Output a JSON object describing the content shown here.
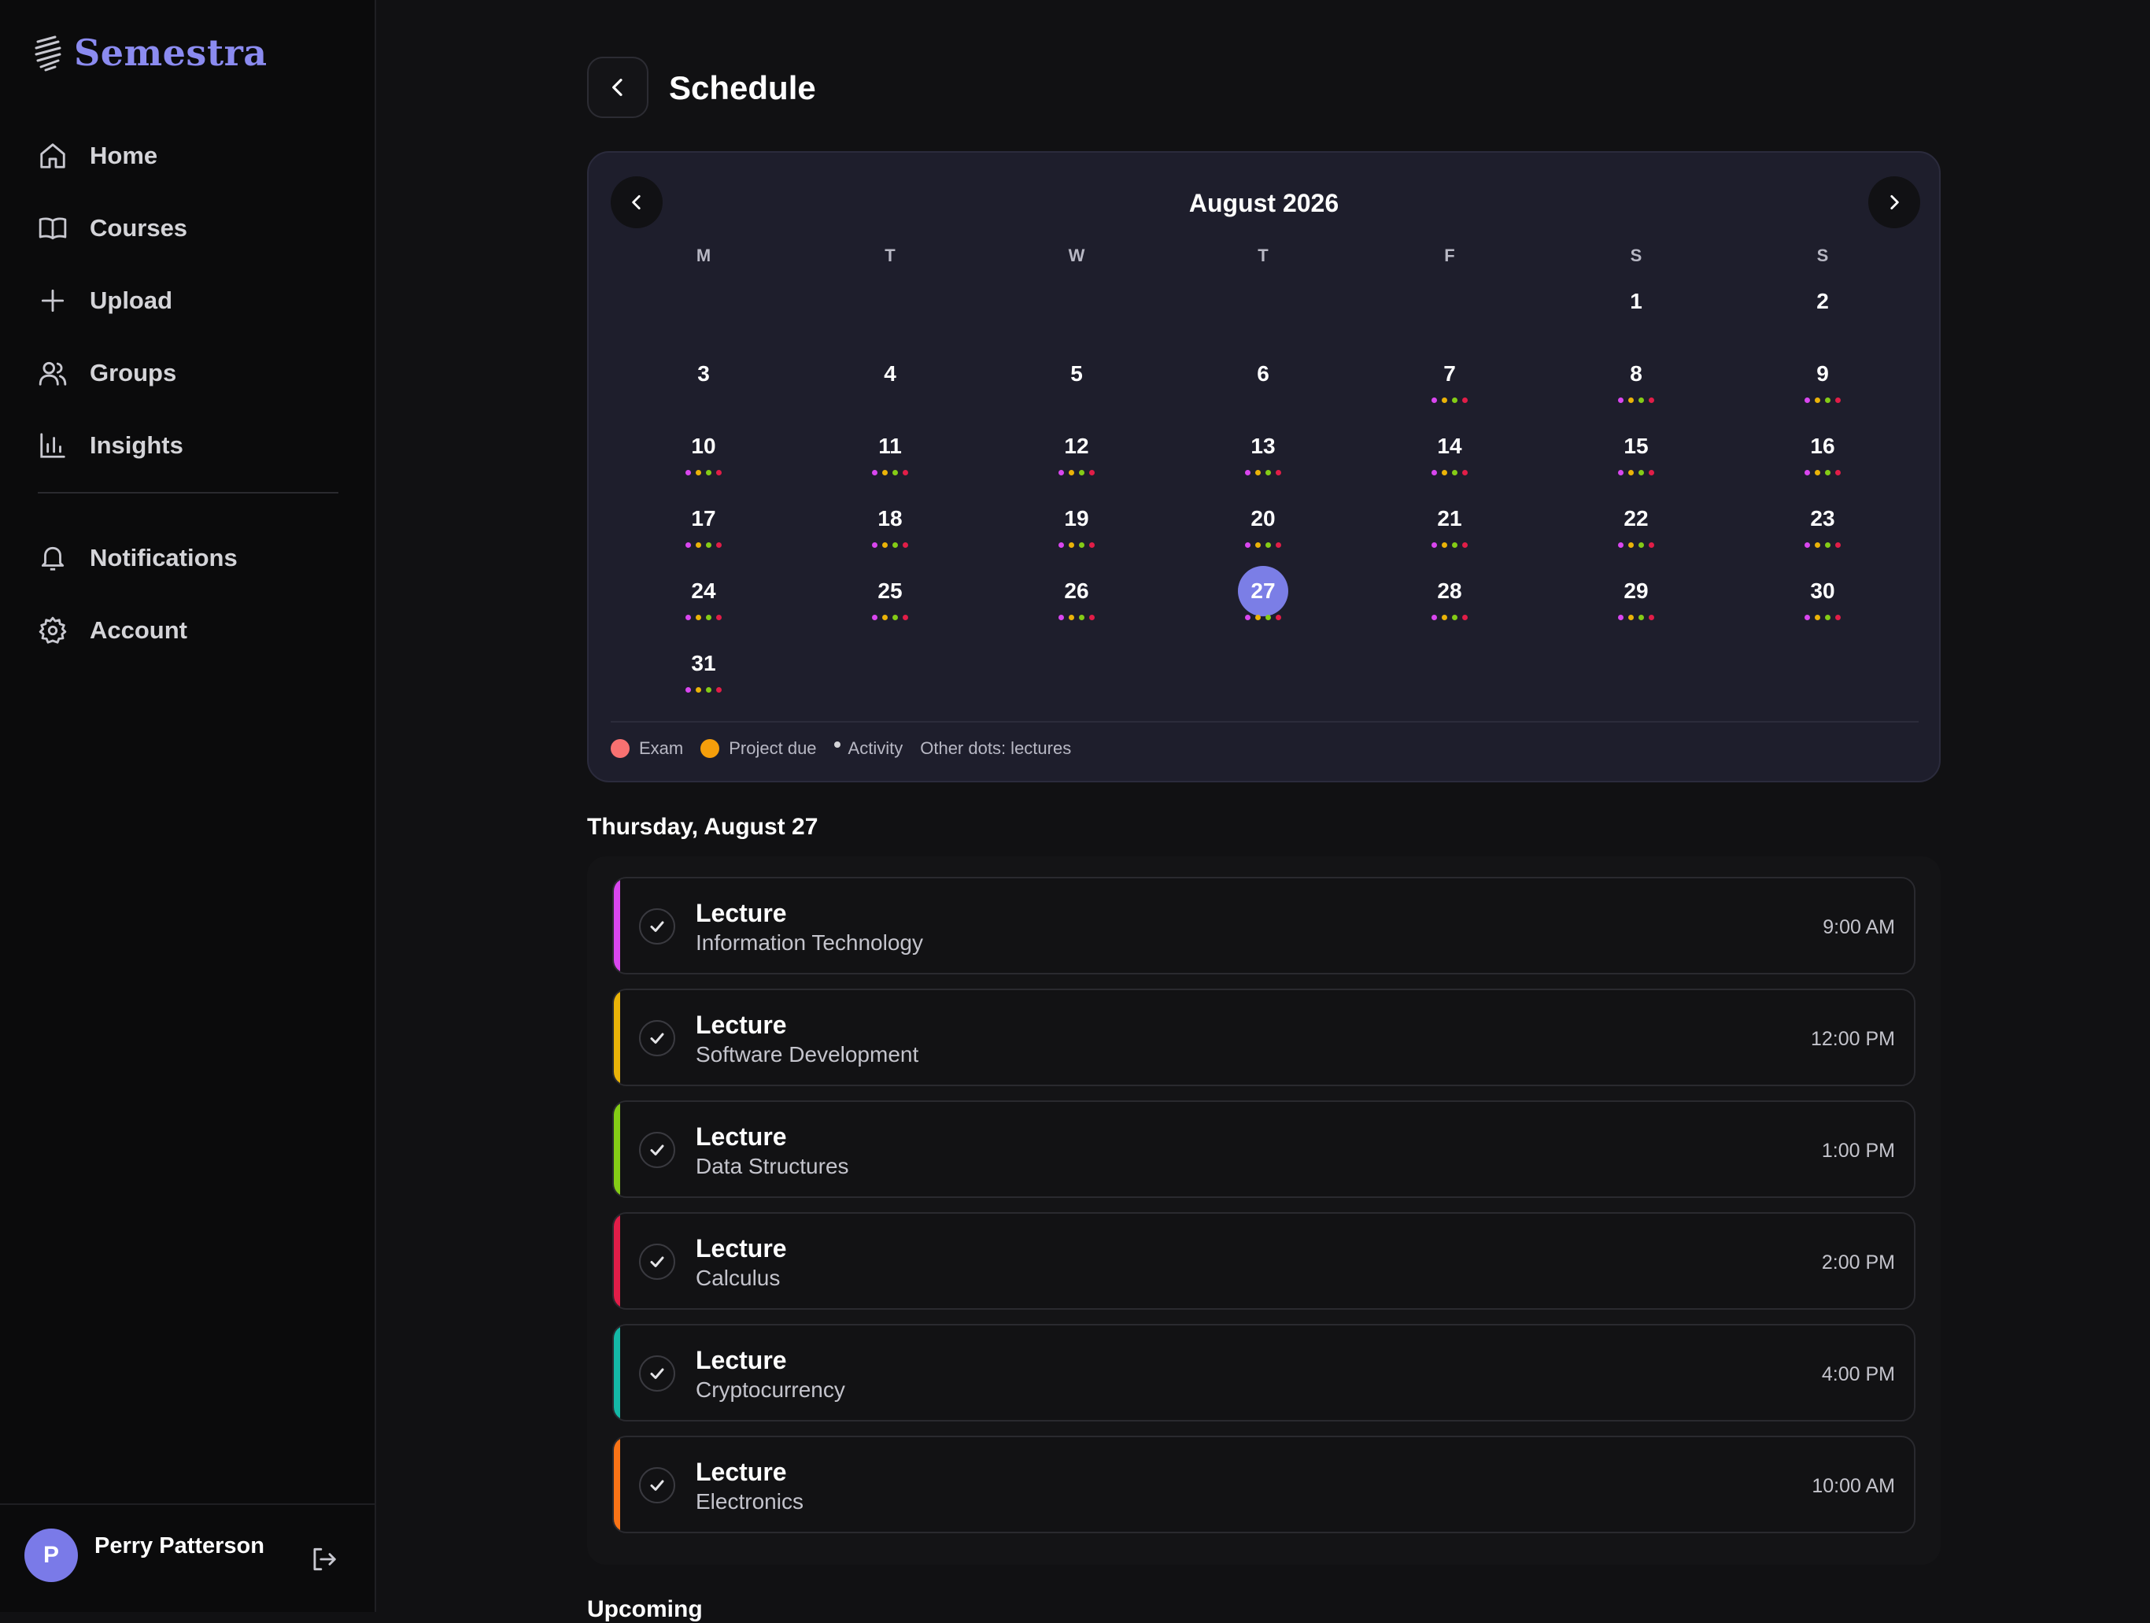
{
  "app": {
    "name": "Semestra"
  },
  "sidebar": {
    "items": [
      {
        "label": "Home",
        "icon": "home-icon"
      },
      {
        "label": "Courses",
        "icon": "book-icon"
      },
      {
        "label": "Upload",
        "icon": "plus-icon"
      },
      {
        "label": "Groups",
        "icon": "users-icon"
      },
      {
        "label": "Insights",
        "icon": "bar-chart-icon"
      }
    ],
    "secondary": [
      {
        "label": "Notifications",
        "icon": "bell-icon"
      },
      {
        "label": "Account",
        "icon": "gear-icon"
      }
    ],
    "user": {
      "initial": "P",
      "name": "Perry Patterson"
    }
  },
  "header": {
    "title": "Schedule"
  },
  "calendar": {
    "month_label": "August 2026",
    "weekdays": [
      "M",
      "T",
      "W",
      "T",
      "F",
      "S",
      "S"
    ],
    "first_weekday_index": 5,
    "days_in_month": 31,
    "selected_day": 27,
    "no_dot_days": [
      1,
      2,
      3,
      4,
      5,
      6
    ],
    "dot_colors": [
      "#d946ef",
      "#eab308",
      "#84cc16",
      "#e11d48"
    ],
    "legend": {
      "exam": "Exam",
      "project": "Project due",
      "activity": "Activity",
      "other": "Other dots: lectures"
    },
    "legend_colors": {
      "exam": "#f87171",
      "project": "#f59e0b"
    }
  },
  "day_view": {
    "heading": "Thursday, August 27",
    "events": [
      {
        "title": "Lecture",
        "course": "Information Technology",
        "time": "9:00 AM",
        "color": "#d946ef"
      },
      {
        "title": "Lecture",
        "course": "Software Development",
        "time": "12:00 PM",
        "color": "#eab308"
      },
      {
        "title": "Lecture",
        "course": "Data Structures",
        "time": "1:00 PM",
        "color": "#84cc16"
      },
      {
        "title": "Lecture",
        "course": "Calculus",
        "time": "2:00 PM",
        "color": "#e11d48"
      },
      {
        "title": "Lecture",
        "course": "Cryptocurrency",
        "time": "4:00 PM",
        "color": "#14b8a6"
      },
      {
        "title": "Lecture",
        "course": "Electronics",
        "time": "10:00 AM",
        "color": "#f97316"
      }
    ]
  },
  "upcoming": {
    "heading": "Upcoming"
  }
}
